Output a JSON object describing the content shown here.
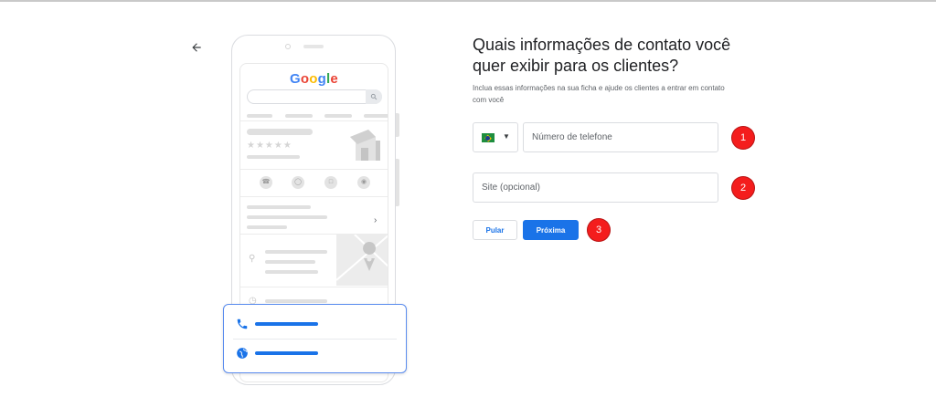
{
  "header": {
    "back_icon": "arrow-left-icon"
  },
  "illustration": {
    "google_logo": {
      "letters": [
        "G",
        "o",
        "o",
        "g",
        "l",
        "e"
      ],
      "colors": [
        "#4285f4",
        "#ea4335",
        "#fbbc05",
        "#4285f4",
        "#34a853",
        "#ea4335"
      ]
    },
    "stars": "★★★★★",
    "action_icons": [
      "phone-icon",
      "directions-icon",
      "bookmark-icon",
      "globe-icon"
    ],
    "card_icons": [
      "phone-icon",
      "globe-icon"
    ]
  },
  "form": {
    "title": "Quais informações de contato você quer exibir para os clientes?",
    "subtitle": "Inclua essas informações na sua ficha e ajude os clientes a entrar em contato com você",
    "country": {
      "selected": "BR",
      "flag_colors": [
        "#1e8e3e",
        "#fbbc04",
        "#1a3f8f"
      ]
    },
    "phone": {
      "placeholder": "Número de telefone",
      "value": ""
    },
    "site": {
      "placeholder": "Site (opcional)",
      "value": ""
    },
    "buttons": {
      "skip": "Pular",
      "next": "Próxima"
    }
  },
  "annotations": [
    "1",
    "2",
    "3"
  ],
  "colors": {
    "accent": "#1a73e8",
    "annotation": "#f41d1d",
    "border": "#dadce0"
  }
}
